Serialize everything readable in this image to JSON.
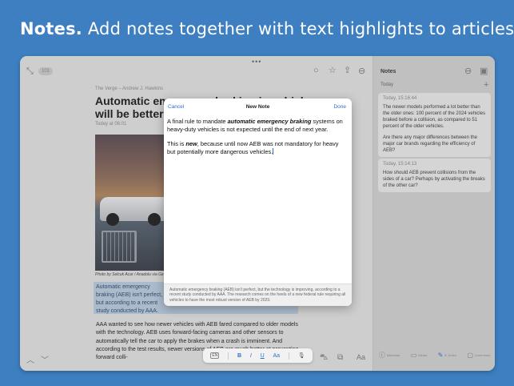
{
  "headline": {
    "bold": "Notes.",
    "rest": " Add notes together with text highlights to articles."
  },
  "reader": {
    "count_badge": "101",
    "byline": "The Verge – Andrew J. Hawkins",
    "title": "Automatic emergency braking in vehicles will be better at preventing collisions",
    "date": "Today at 06:01",
    "caption": "Photo by Selcuk Acar / Anadolu via Getty",
    "highlight": "Automatic emergency braking (AEB) isn't perfect, but according to a recent study conducted by AAA. The research comes on the heels of a new federal rule requiring all vehicles to have the most robust version of AEB by 2029.",
    "paragraph": "AAA wanted to see how newer vehicles with AEB fared compared to older models with the technology. AEB uses forward-facing cameras and other sensors to automatically tell the car to apply the brakes when a crash is imminent. And according to the test results, newer versions of AEB are much better at preventing forward colli-",
    "format_bar": {
      "lang": "EN",
      "bold": "B",
      "italic": "I",
      "underline": "U",
      "size": "Aa",
      "mic": "🎙"
    }
  },
  "notes": {
    "title": "Notes",
    "section": "Today",
    "cards": [
      {
        "timestamp": "Today, 15:16:44",
        "para1": "The newer models performed a lot better than the older ones: 100 percent of the 2024 vehicles braked before a collision, as compared to 51 percent of the older vehicles.",
        "para2": "Are there any major differences between the major car brands regarding the efficiency of AEB?"
      },
      {
        "timestamp": "Today, 15:14:13",
        "para1": "How should AEB prevent collisions from the sides of a car? Perhaps by activating the breaks of the other car?"
      }
    ],
    "bottom": [
      {
        "icon": "info-icon",
        "label": "Metadata"
      },
      {
        "icon": "media-icon",
        "label": "Media"
      },
      {
        "icon": "notes-icon",
        "label": "Notes",
        "badge": "2"
      },
      {
        "icon": "comments-icon",
        "label": "Comments"
      }
    ]
  },
  "modal": {
    "cancel": "Cancel",
    "title": "New Note",
    "done": "Done",
    "p1_a": "A final rule to mandate ",
    "p1_em": "automatic emergency braking",
    "p1_b": " systems on heavy-duty vehicles is not expected until the end of next year.",
    "p2_a": "This is ",
    "p2_em": "new",
    "p2_b": ", because until now AEB was not mandatory for heavy but potentially more dangerous vehicles.",
    "quote": "Automatic emergency braking (AEB) isn't perfect, but the technology is improving, according to a recent study conducted by AAA. The research comes on the heels of a new federal rule requiring all vehicles to have the most robust version of AEB by 2029."
  }
}
